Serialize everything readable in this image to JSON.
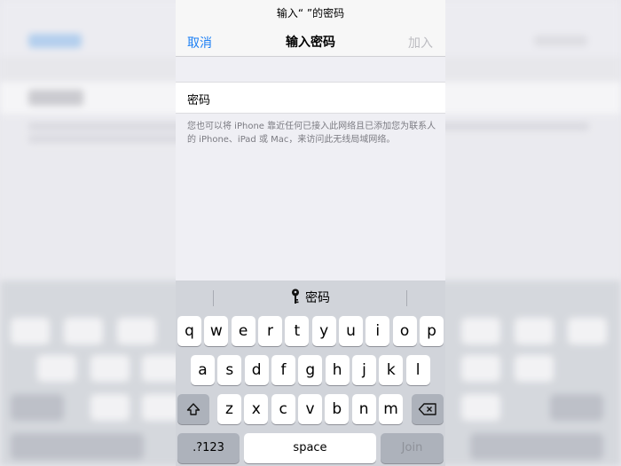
{
  "prompt": "输入“        ”的密码",
  "nav": {
    "cancel": "取消",
    "title": "输入密码",
    "join": "加入"
  },
  "password": {
    "label": "密码",
    "value": ""
  },
  "note": "您也可以将 iPhone 靠近任何已接入此网络且已添加您为联系人的 iPhone、iPad 或 Mac，来访问此无线局域网络。",
  "keyboard": {
    "suggestion": "密码",
    "rows": [
      [
        "q",
        "w",
        "e",
        "r",
        "t",
        "y",
        "u",
        "i",
        "o",
        "p"
      ],
      [
        "a",
        "s",
        "d",
        "f",
        "g",
        "h",
        "j",
        "k",
        "l"
      ],
      [
        "z",
        "x",
        "c",
        "v",
        "b",
        "n",
        "m"
      ]
    ],
    "numbers_key": ".?123",
    "space_key": "space",
    "join_key": "Join"
  },
  "colors": {
    "accent": "#1c7ff4",
    "disabled": "#bdbdc2"
  }
}
